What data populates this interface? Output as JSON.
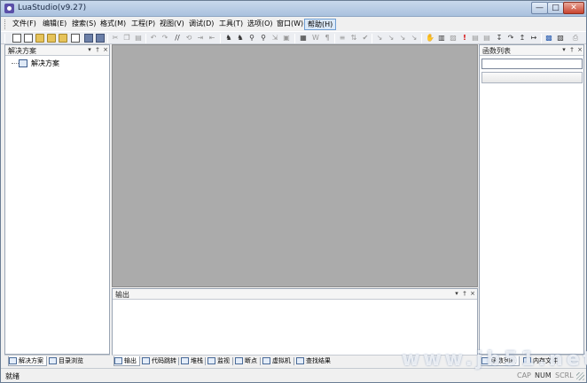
{
  "window": {
    "title": "LuaStudio(v9.27)",
    "minimize": "—",
    "maximize": "□",
    "close": "✕"
  },
  "menu": [
    "文件(F)",
    "编辑(E)",
    "搜索(S)",
    "格式(M)",
    "工程(P)",
    "视图(V)",
    "调试(D)",
    "工具(T)",
    "选项(O)",
    "窗口(W)",
    "帮助(H)"
  ],
  "active_menu": "帮助(H)",
  "toolbar_icons": [
    "new-file-icon",
    "new-project-icon",
    "open-file-icon",
    "open-folder-icon",
    "open-recent-icon",
    "export-icon",
    "save-icon",
    "save-all-icon",
    "cut-icon",
    "copy-icon",
    "paste-icon",
    "undo-icon",
    "redo-icon",
    "comment-icon",
    "uncomment-icon",
    "indent-icon",
    "outdent-icon",
    "find-icon",
    "find-next-icon",
    "find-in-files-icon",
    "replace-icon",
    "goto-icon",
    "bookmark-icon",
    "whitespace-icon",
    "word-wrap-icon",
    "paragraph-icon",
    "format-icon",
    "sort-icon",
    "check-icon",
    "build-icon",
    "rebuild-icon",
    "clean-icon",
    "run-icon",
    "stop-icon",
    "hand-icon",
    "grid-icon",
    "breakpoint-icon",
    "alert-icon",
    "watch-icon",
    "locals-icon",
    "step-into-icon",
    "step-over-icon",
    "step-out-icon",
    "run-to-cursor-icon",
    "help-icon",
    "about-icon",
    "print-icon"
  ],
  "solution_panel": {
    "title": "解决方案",
    "tree_root": "解决方案"
  },
  "function_panel": {
    "title": "函数列表"
  },
  "output_panel": {
    "title": "输出"
  },
  "panel_buttons": {
    "dropdown": "▾",
    "pin": "†",
    "close": "×"
  },
  "left_tabs": [
    "解决方案",
    "目录浏览"
  ],
  "bottom_tabs": [
    "输出",
    "代码跳转",
    "堆栈",
    "监视",
    "断点",
    "虚拟机",
    "查找结果"
  ],
  "right_tabs": [
    "函数列表",
    "内存文件"
  ],
  "status": {
    "text": "就绪",
    "cap": "CAP",
    "num": "NUM",
    "scrl": "SCRL"
  },
  "watermark": "www.jb51.net"
}
